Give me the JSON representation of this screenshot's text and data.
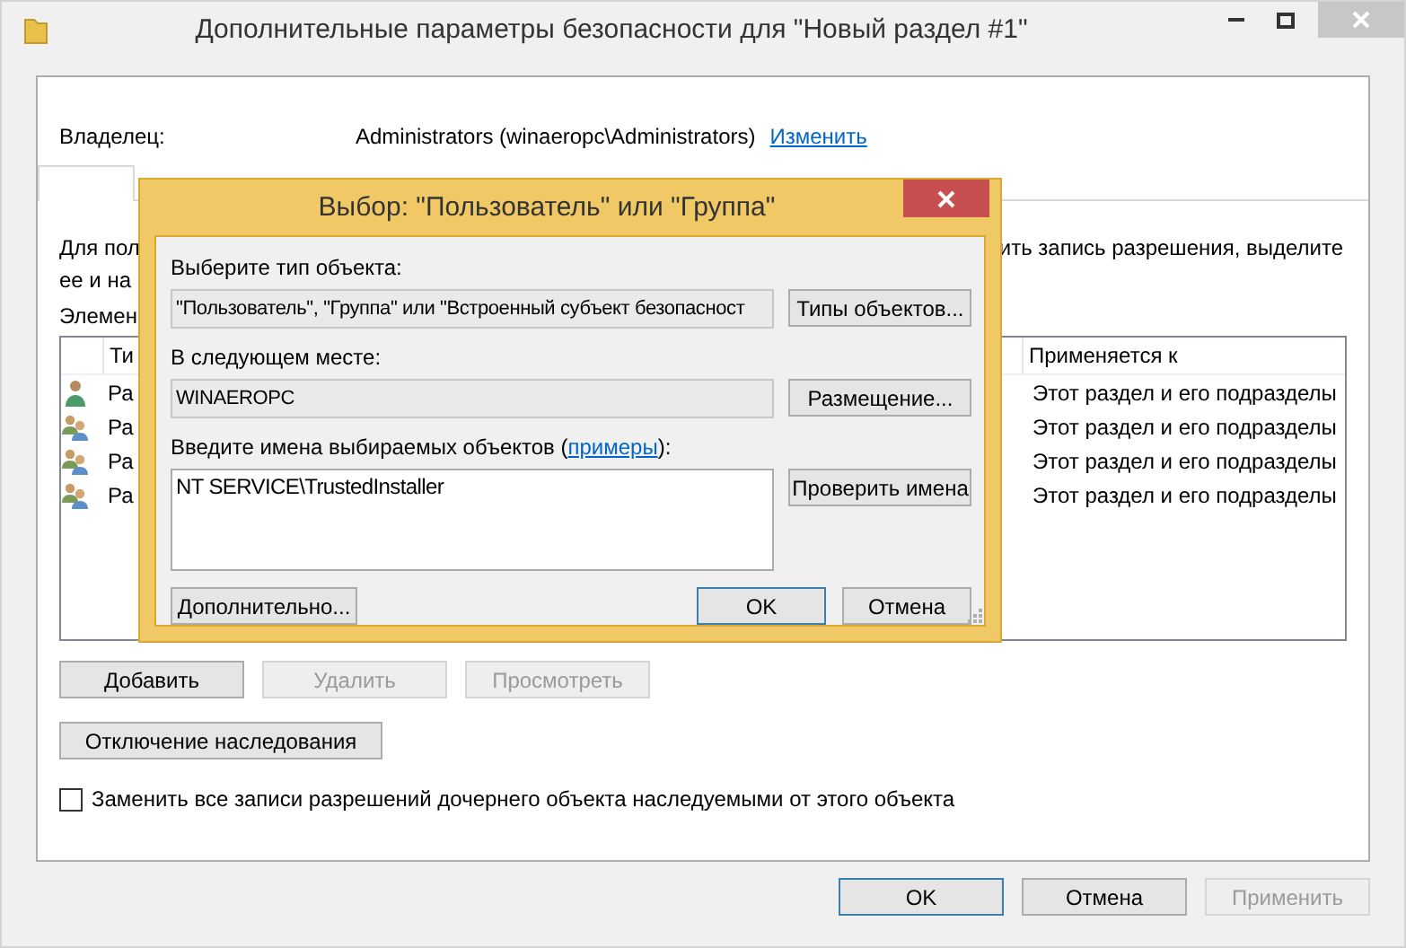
{
  "window": {
    "title": "Дополнительные параметры безопасности  для \"Новый раздел #1\""
  },
  "owner": {
    "label": "Владелец:",
    "value": "Administrators (winaeropc\\Administrators)",
    "link": "Изменить"
  },
  "tabs": [
    {
      "selected": true
    }
  ],
  "description": {
    "lines": [
      "Для пол",
      "ее и на"
    ],
    "continuation": "ить запись разрешения, выделите"
  },
  "entries_label": "Элемен",
  "table": {
    "columns": [
      "Ти",
      "Применяется к"
    ],
    "rows": [
      {
        "kind": "user",
        "type": "Ра",
        "applies_to": "Этот раздел и его подразделы"
      },
      {
        "kind": "group",
        "type": "Ра",
        "applies_to": "Этот раздел и его подразделы"
      },
      {
        "kind": "group",
        "type": "Ра",
        "applies_to": "Этот раздел и его подразделы"
      },
      {
        "kind": "group",
        "type": "Ра",
        "applies_to": "Этот раздел и его подразделы"
      }
    ]
  },
  "actions": [
    {
      "label": "Добавить",
      "disabled": false
    },
    {
      "label": "Удалить",
      "disabled": true
    },
    {
      "label": "Просмотреть",
      "disabled": true
    }
  ],
  "inheritance_button": "Отключение наследования",
  "replace_checkbox": {
    "label": "Заменить все записи разрешений дочернего объекта наследуемыми от этого объекта",
    "checked": false
  },
  "footer_buttons": [
    {
      "label": "OK",
      "default": true,
      "disabled": false
    },
    {
      "label": "Отмена",
      "default": false,
      "disabled": false
    },
    {
      "label": "Применить",
      "default": false,
      "disabled": true
    }
  ],
  "dialog": {
    "title": "Выбор: \"Пользователь\" или \"Группа\"",
    "fields": [
      {
        "label": "Выберите тип объекта:",
        "value": "\"Пользователь\", \"Группа\" или \"Встроенный субъект безопасност",
        "button": "Типы объектов..."
      },
      {
        "label": "В следующем месте:",
        "value": "WINAEROPC",
        "button": "Размещение..."
      }
    ],
    "names": {
      "label_before": "Введите имена выбираемых объектов (",
      "link": "примеры",
      "label_after": "):",
      "value": "NT SERVICE\\TrustedInstaller",
      "button": "Проверить имена"
    },
    "advanced_button": "Дополнительно...",
    "buttons": [
      {
        "label": "OK",
        "default": true
      },
      {
        "label": "Отмена",
        "default": false
      }
    ]
  }
}
